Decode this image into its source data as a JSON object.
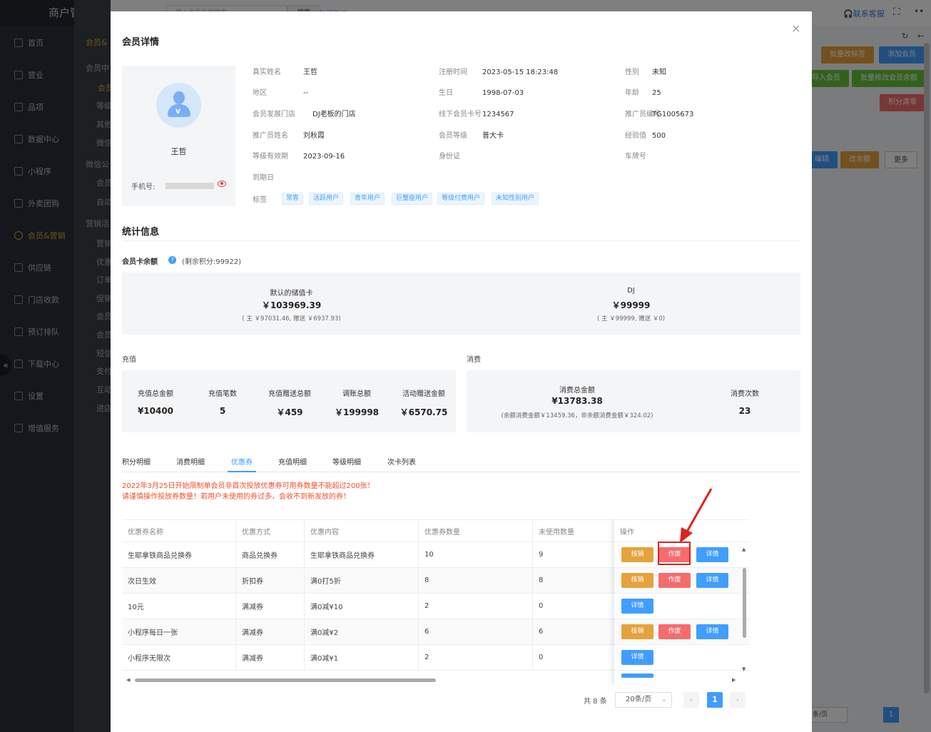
{
  "app": {
    "brand": "商户管理平台",
    "top_search_placeholder": "输入会员名称搜索",
    "top_search_btn": "搜索",
    "top_link": "前往数据看板",
    "contact": "联系客服",
    "nav": [
      "首页",
      "营业",
      "品项",
      "数据中心",
      "小程序",
      "外卖团购",
      "会员&营销",
      "供应链",
      "门店收款",
      "预订排队",
      "下载中心",
      "设置",
      "增值服务"
    ],
    "subnav": [
      "会员&",
      "会员中",
      "会员",
      "等级",
      "其他",
      "微信",
      "微信公",
      "会员",
      "自动",
      "营销活",
      "营销",
      "优惠",
      "订单",
      "促销",
      "会员",
      "会员",
      "短信",
      "支付",
      "互动",
      "进店"
    ],
    "bg_buttons": [
      "批量改标签",
      "添加会员",
      "导入会员",
      "批量修改会员余额",
      "积分清零",
      "编辑",
      "改余额",
      "更多"
    ],
    "bg_pager_size": "条/页",
    "bg_pager_page": "1"
  },
  "modal": {
    "title": "会员详情",
    "close": "×",
    "profile": {
      "name": "王哲",
      "phone_label": "手机号:"
    },
    "info": [
      {
        "label": "真实姓名",
        "value": "王哲"
      },
      {
        "label": "注册时间",
        "value": "2023-05-15 18:23:48"
      },
      {
        "label": "性别",
        "value": "未知"
      },
      {
        "label": "地区",
        "value": "--"
      },
      {
        "label": "生日",
        "value": "1998-07-03"
      },
      {
        "label": "年龄",
        "value": "25"
      },
      {
        "label": "会员发展门店",
        "value": "DJ老板的门店"
      },
      {
        "label": "线下会员卡号",
        "value": "1234567"
      },
      {
        "label": "推广员编号",
        "value": "TG1005673"
      },
      {
        "label": "推广员姓名",
        "value": "刘秋霞"
      },
      {
        "label": "会员等级",
        "value": "普大卡"
      },
      {
        "label": "经验值",
        "value": "500"
      },
      {
        "label": "等级有效期",
        "value": "2023-09-16"
      },
      {
        "label": "身份证",
        "value": ""
      },
      {
        "label": "车牌号",
        "value": ""
      },
      {
        "label": "到期日",
        "value": ""
      }
    ],
    "tags_label": "标签",
    "tags": [
      "常客",
      "活跃用户",
      "青年用户",
      "巨蟹座用户",
      "等级付费用户",
      "未知性别用户"
    ],
    "stats_title": "统计信息",
    "balance_label": "会员卡余额",
    "balance_points": "(剩余积分:99922)",
    "cards": [
      {
        "name": "默认的储值卡",
        "amount": "￥103969.39",
        "detail": "( 主 ￥97031.46, 赠送 ￥6937.93)"
      },
      {
        "name": "DJ",
        "amount": "￥99999",
        "detail": "( 主 ￥99999, 赠送 ￥0)"
      }
    ],
    "recharge_title": "充值",
    "recharge": [
      {
        "label": "充值总金额",
        "value": "¥10400"
      },
      {
        "label": "充值笔数",
        "value": "5"
      },
      {
        "label": "充值赠送总额",
        "value": "￥459"
      },
      {
        "label": "调账总额",
        "value": "￥199998"
      },
      {
        "label": "活动赠送金额",
        "value": "￥6570.75"
      }
    ],
    "consume_title": "消费",
    "consume": {
      "total_label": "消费总金额",
      "total_value": "¥13783.38",
      "total_detail": "(余额消费金额￥13459.36，非余额消费金额￥324.02)",
      "count_label": "消费次数",
      "count_value": "23"
    },
    "tabs": [
      "积分明细",
      "消费明细",
      "优惠券",
      "充值明细",
      "等级明细",
      "次卡列表"
    ],
    "active_tab": "优惠券",
    "warning": "2022年3月25日开始限制单会员非首次投放优惠券可用券数量不能超过200张！请谨慎操作投放券数量！若用户未使用的券过多，会收不到新发放的券！",
    "table": {
      "columns": [
        "优惠券名称",
        "优惠方式",
        "优惠内容",
        "优惠券数量",
        "未使用数量",
        "操作"
      ],
      "rows": [
        {
          "name": "生耶拿铁商品兑换券",
          "type": "商品兑换券",
          "content": "生耶拿铁商品兑换券",
          "qty": "10",
          "unused": "9",
          "ops": [
            "核销",
            "作废",
            "详情"
          ]
        },
        {
          "name": "次日生效",
          "type": "折扣券",
          "content": "满0打5折",
          "qty": "8",
          "unused": "8",
          "ops": [
            "核销",
            "作废",
            "详情"
          ]
        },
        {
          "name": "10元",
          "type": "满减券",
          "content": "满0减¥10",
          "qty": "2",
          "unused": "0",
          "ops": [
            "详情"
          ]
        },
        {
          "name": "小程序每日一张",
          "type": "满减券",
          "content": "满0减¥2",
          "qty": "6",
          "unused": "6",
          "ops": [
            "核销",
            "作废",
            "详情"
          ]
        },
        {
          "name": "小程序无限次",
          "type": "满减券",
          "content": "满0减¥1",
          "qty": "2",
          "unused": "0",
          "ops": [
            "详情"
          ]
        }
      ]
    },
    "pager": {
      "total": "共 8 条",
      "size": "20条/页",
      "current": "1",
      "prev": "‹",
      "next": "›"
    },
    "colors": {
      "accent": "#409eff",
      "warn": "#f0502a",
      "orange": "#e6a23c",
      "red": "#f56c6c",
      "highlight": "#e02020"
    }
  }
}
